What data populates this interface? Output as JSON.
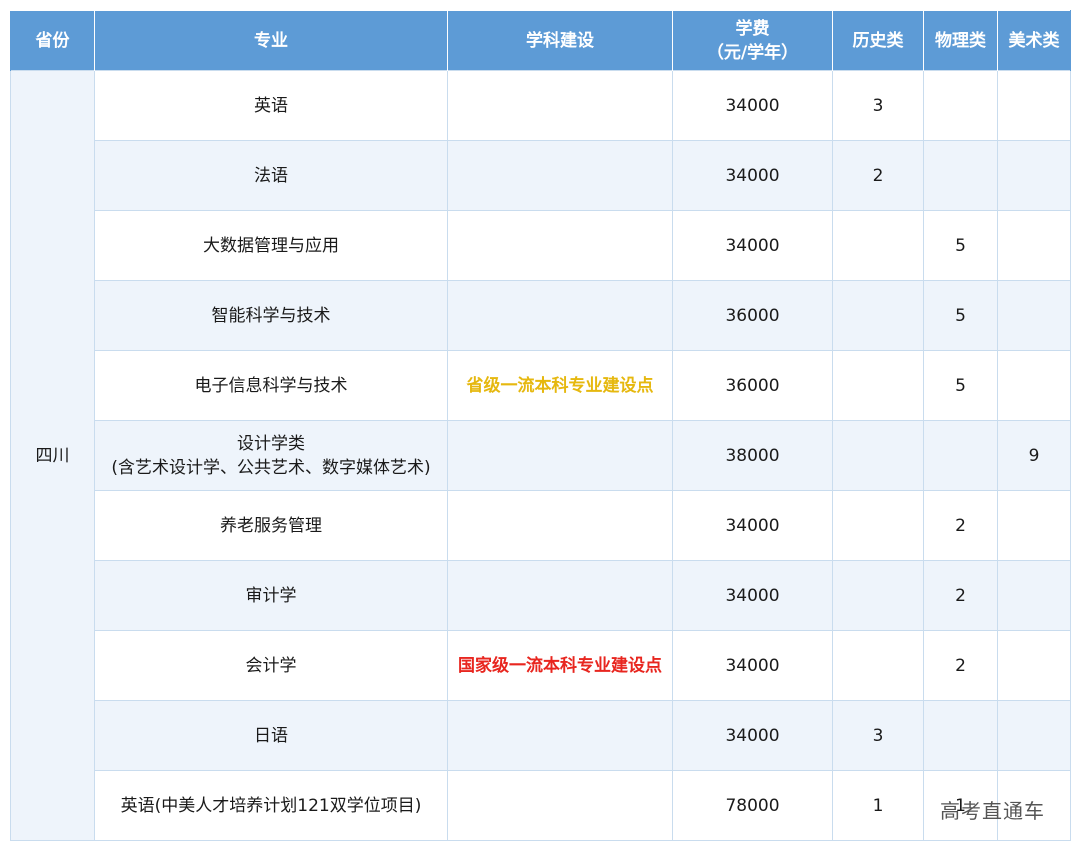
{
  "header": {
    "province": "省份",
    "major": "专业",
    "discipline": "学科建设",
    "tuition_line1": "学费",
    "tuition_line2": "（元/学年）",
    "history": "历史类",
    "physics": "物理类",
    "art": "美术类"
  },
  "province": "四川",
  "rows": [
    {
      "major": "英语",
      "major_sub": "",
      "discipline": "",
      "discipline_level": "",
      "tuition": "34000",
      "history": "3",
      "physics": "",
      "art": ""
    },
    {
      "major": "法语",
      "major_sub": "",
      "discipline": "",
      "discipline_level": "",
      "tuition": "34000",
      "history": "2",
      "physics": "",
      "art": ""
    },
    {
      "major": "大数据管理与应用",
      "major_sub": "",
      "discipline": "",
      "discipline_level": "",
      "tuition": "34000",
      "history": "",
      "physics": "5",
      "art": ""
    },
    {
      "major": "智能科学与技术",
      "major_sub": "",
      "discipline": "",
      "discipline_level": "",
      "tuition": "36000",
      "history": "",
      "physics": "5",
      "art": ""
    },
    {
      "major": "电子信息科学与技术",
      "major_sub": "",
      "discipline": "省级一流本科专业建设点",
      "discipline_level": "provincial",
      "tuition": "36000",
      "history": "",
      "physics": "5",
      "art": ""
    },
    {
      "major": "设计学类",
      "major_sub": "(含艺术设计学、公共艺术、数字媒体艺术)",
      "discipline": "",
      "discipline_level": "",
      "tuition": "38000",
      "history": "",
      "physics": "",
      "art": "9"
    },
    {
      "major": "养老服务管理",
      "major_sub": "",
      "discipline": "",
      "discipline_level": "",
      "tuition": "34000",
      "history": "",
      "physics": "2",
      "art": ""
    },
    {
      "major": "审计学",
      "major_sub": "",
      "discipline": "",
      "discipline_level": "",
      "tuition": "34000",
      "history": "",
      "physics": "2",
      "art": ""
    },
    {
      "major": "会计学",
      "major_sub": "",
      "discipline": "国家级一流本科专业建设点",
      "discipline_level": "national",
      "tuition": "34000",
      "history": "",
      "physics": "2",
      "art": ""
    },
    {
      "major": "日语",
      "major_sub": "",
      "discipline": "",
      "discipline_level": "",
      "tuition": "34000",
      "history": "3",
      "physics": "",
      "art": ""
    },
    {
      "major": "英语(中美人才培养计划121双学位项目)",
      "major_sub": "",
      "discipline": "",
      "discipline_level": "",
      "tuition": "78000",
      "history": "1",
      "physics": "1",
      "art": ""
    }
  ],
  "watermark": "高考直通车",
  "colors": {
    "header_bg": "#5d9bd6",
    "stripe_bg": "#eef4fb",
    "provincial_text": "#e6b80f",
    "national_text": "#e8261f"
  }
}
